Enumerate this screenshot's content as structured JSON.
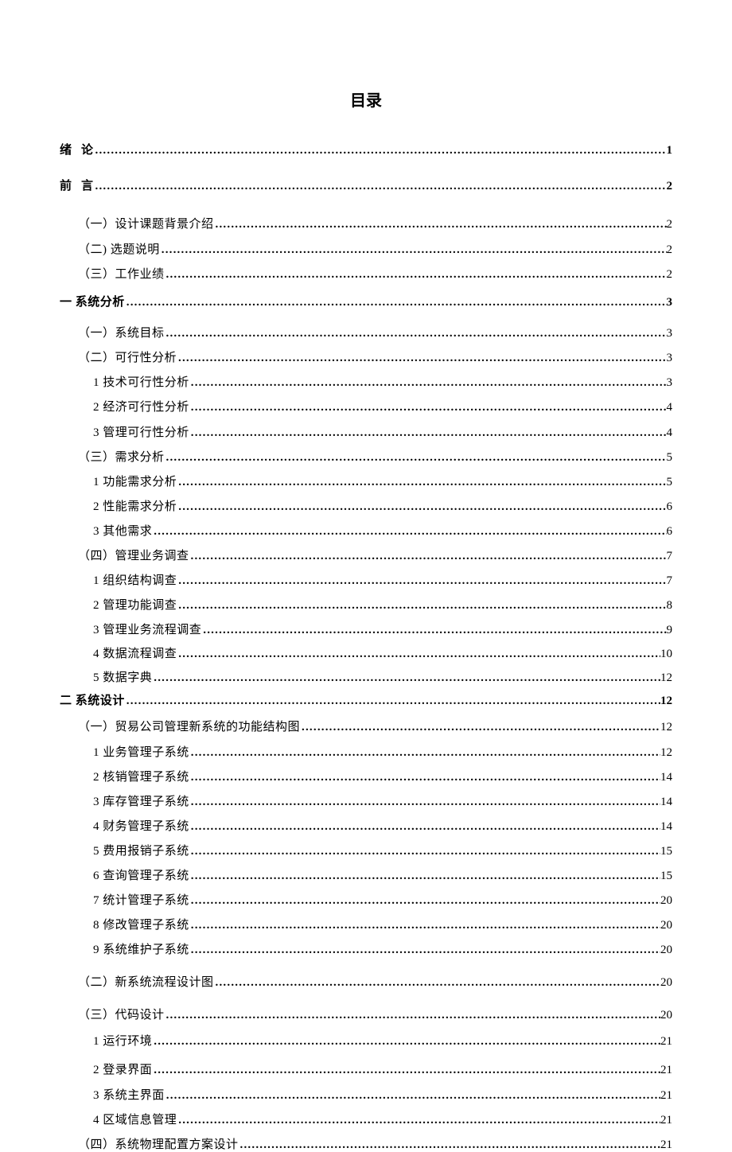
{
  "title": "目录",
  "entries": [
    {
      "level": 1,
      "label_pre": "绪",
      "label_post": "论",
      "page": "1",
      "spaced": true,
      "sp": "sp-24"
    },
    {
      "level": 1,
      "label_pre": "前",
      "label_post": "言",
      "page": "2",
      "spaced": true,
      "sp": "sp-27"
    },
    {
      "level": 2,
      "label": "（一）设计课题背景介绍",
      "page": "2",
      "sp": "sp-11"
    },
    {
      "level": 2,
      "label": "（二) 选题说明",
      "page": "2",
      "sp": "sp-10"
    },
    {
      "level": 2,
      "label": "（三）工作业绩",
      "page": "2",
      "sp": "sp-14"
    },
    {
      "level": 1,
      "label": "一 系统分析",
      "page": "3",
      "sp": "sp-18"
    },
    {
      "level": 2,
      "label": "（一）系统目标",
      "page": "3",
      "sp": "sp-10"
    },
    {
      "level": 2,
      "label": "（二）可行性分析",
      "page": "3",
      "sp": "sp-10"
    },
    {
      "level": 3,
      "label": "1 技术可行性分析",
      "page": "3",
      "sp": "sp-10"
    },
    {
      "level": 3,
      "label": "2 经济可行性分析",
      "page": "4",
      "sp": "sp-11"
    },
    {
      "level": 3,
      "label": "3 管理可行性分析",
      "page": "4",
      "sp": "sp-10"
    },
    {
      "level": 2,
      "label": "（三）需求分析",
      "page": "5",
      "sp": "sp-10"
    },
    {
      "level": 3,
      "label": "1 功能需求分析",
      "page": "5",
      "sp": "sp-10"
    },
    {
      "level": 3,
      "label": "2 性能需求分析",
      "page": "6",
      "sp": "sp-10"
    },
    {
      "level": 3,
      "label": "3  其他需求",
      "page": "6",
      "sp": "sp-10"
    },
    {
      "level": 2,
      "label": "（四）管理业务调查",
      "page": "7",
      "sp": "sp-10"
    },
    {
      "level": 3,
      "label": "1 组织结构调查",
      "page": "7",
      "sp": "sp-10"
    },
    {
      "level": 3,
      "label": "2 管理功能调查",
      "page": "8",
      "sp": "sp-10"
    },
    {
      "level": 3,
      "label": "3 管理业务流程调查",
      "page": "9",
      "sp": "sp-9"
    },
    {
      "level": 3,
      "label": "4 数据流程调查 ",
      "page": "10",
      "sp": "sp-9"
    },
    {
      "level": 3,
      "label": "5 数据字典  ",
      "page": "12",
      "sp": "sp-8"
    },
    {
      "level": 1,
      "label": "二 系统设计",
      "page": "12",
      "sp": "sp-12"
    },
    {
      "level": 2,
      "label": "（一）贸易公司管理新系统的功能结构图",
      "page": "12",
      "sp": "sp-11"
    },
    {
      "level": 3,
      "label": "1 业务管理子系统",
      "page": "12",
      "sp": "sp-10"
    },
    {
      "level": 3,
      "label": "2 核销管理子系统",
      "page": "14",
      "sp": "sp-10"
    },
    {
      "level": 3,
      "label": "3 库存管理子系统",
      "page": "14",
      "sp": "sp-10"
    },
    {
      "level": 3,
      "label": "4 财务管理子系统",
      "page": "14",
      "sp": "sp-10"
    },
    {
      "level": 3,
      "label": "5 费用报销子系统",
      "page": "15",
      "sp": "sp-10"
    },
    {
      "level": 3,
      "label": "6 查询管理子系统",
      "page": "15",
      "sp": "sp-10"
    },
    {
      "level": 3,
      "label": "7 统计管理子系统",
      "page": "20",
      "sp": "sp-10"
    },
    {
      "level": 3,
      "label": "8 修改管理子系统",
      "page": "20",
      "sp": "sp-10"
    },
    {
      "level": 3,
      "label": "9 系统维护子系统",
      "page": "20",
      "sp": "sp-20"
    },
    {
      "level": 2,
      "label": "（二）新系统流程设计图",
      "page": "20",
      "sp": "sp-20"
    },
    {
      "level": 2,
      "label": "（三）代码设计",
      "page": "20",
      "sp": "sp-12"
    },
    {
      "level": 3,
      "label": "1 运行环境",
      "page": "21",
      "sp": "sp-15"
    },
    {
      "level": 3,
      "label": "2 登录界面",
      "page": "21",
      "sp": "sp-11"
    },
    {
      "level": 3,
      "label": "3 系统主界面",
      "page": "21",
      "sp": "sp-10"
    },
    {
      "level": 3,
      "label": "4 区域信息管理",
      "page": "21",
      "sp": "sp-10"
    },
    {
      "level": 2,
      "label": "（四）系统物理配置方案设计",
      "page": "21",
      "sp": "sp-10"
    }
  ]
}
